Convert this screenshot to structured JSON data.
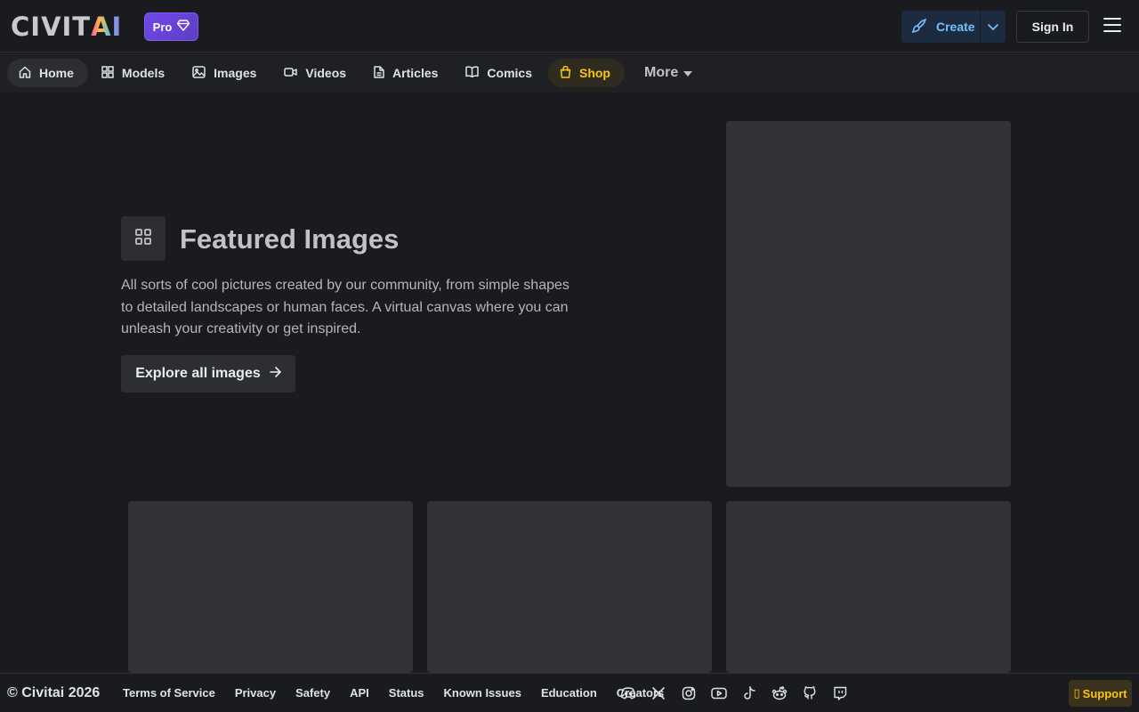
{
  "header": {
    "logo": {
      "prefix": "CIVIT",
      "suffix": "AI"
    },
    "pro_label": "Pro",
    "create_label": "Create",
    "signin_label": "Sign In"
  },
  "nav": {
    "items": [
      {
        "label": "Home",
        "icon": "home-icon"
      },
      {
        "label": "Models",
        "icon": "grid-icon"
      },
      {
        "label": "Images",
        "icon": "image-icon"
      },
      {
        "label": "Videos",
        "icon": "video-icon"
      },
      {
        "label": "Articles",
        "icon": "article-icon"
      },
      {
        "label": "Comics",
        "icon": "book-icon"
      },
      {
        "label": "Shop",
        "icon": "shopping-bag-icon"
      }
    ],
    "more_label": "More"
  },
  "hero": {
    "title": "Featured Images",
    "description": "All sorts of cool pictures created by our community, from simple shapes to detailed landscapes or human faces. A virtual canvas where you can unleash your creativity or get inspired.",
    "cta_label": "Explore all images"
  },
  "footer": {
    "copyright": "© Civitai 2026",
    "links": [
      "Terms of Service",
      "Privacy",
      "Safety",
      "API",
      "Status",
      "Known Issues",
      "Education",
      "Creators"
    ],
    "socials": [
      "discord-icon",
      "x-icon",
      "instagram-icon",
      "youtube-icon",
      "tiktok-icon",
      "reddit-icon",
      "github-icon",
      "twitch-icon"
    ],
    "support_label": "Support"
  },
  "colors": {
    "background": "#1a1b1e",
    "accent_blue": "#74c0fc",
    "pro_violet": "#7048e8",
    "shop_yellow": "#fcc419",
    "placeholder": "#313338"
  }
}
